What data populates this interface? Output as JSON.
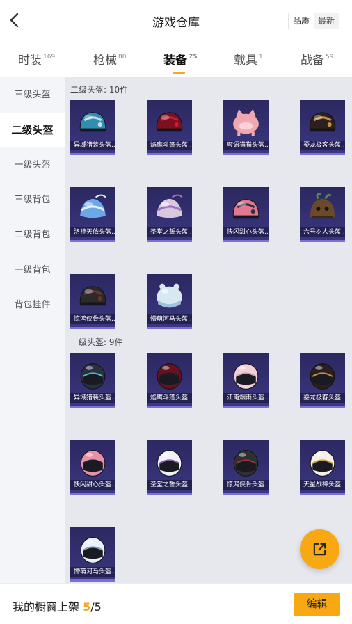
{
  "header": {
    "title": "游戏仓库",
    "sort_options": [
      "品质",
      "最新"
    ],
    "sort_selected": "品质"
  },
  "tabs": [
    {
      "label": "时装",
      "count": "169"
    },
    {
      "label": "枪械",
      "count": "80"
    },
    {
      "label": "装备",
      "count": "75",
      "active": true
    },
    {
      "label": "载具",
      "count": "1"
    },
    {
      "label": "战备",
      "count": "59"
    }
  ],
  "sidebar": {
    "items": [
      "三级头盔",
      "二级头盔",
      "一级头盔",
      "三级背包",
      "二级背包",
      "一级背包",
      "背包挂件"
    ],
    "active_index": 1
  },
  "sections": [
    {
      "title": "二级头盔: 10件",
      "items": [
        {
          "name": "异域猎装头盔...",
          "color": "#2f8fb0",
          "accent": "#c8d8e8",
          "icon": "cap-helmet-icon"
        },
        {
          "name": "焰鹰斗篷头盔...",
          "color": "#7a1020",
          "accent": "#c0203a",
          "icon": "cap-helmet-icon"
        },
        {
          "name": "蜜语猫猫头盔...",
          "color": "#f0a8b0",
          "accent": "#ffd0d8",
          "icon": "cat-helmet-icon"
        },
        {
          "name": "鎏龙极客头盔...",
          "color": "#2a2020",
          "accent": "#c89040",
          "icon": "cap-helmet-icon"
        },
        {
          "name": "洛神天依头盔...",
          "color": "#6aa8e8",
          "accent": "#e0f0ff",
          "icon": "ornate-helmet-icon"
        },
        {
          "name": "圣堂之誓头盔...",
          "color": "#d8c8e0",
          "accent": "#a070c0",
          "icon": "ornate-helmet-icon"
        },
        {
          "name": "快闪甜心头盔...",
          "color": "#e07890",
          "accent": "#303040",
          "icon": "cap-helmet-icon"
        },
        {
          "name": "六号树人头盔...",
          "color": "#6a4a2a",
          "accent": "#5a8a3a",
          "icon": "tree-helmet-icon"
        },
        {
          "name": "惊鸿侠骨头盔...",
          "color": "#2a2a2a",
          "accent": "#703030",
          "icon": "cap-helmet-icon"
        },
        {
          "name": "懵萌河马头盔...",
          "color": "#d8e8f0",
          "accent": "#a0c0e0",
          "icon": "hippo-helmet-icon"
        }
      ]
    },
    {
      "title": "一级头盔: 9件",
      "items": [
        {
          "name": "异域猎装头盔...",
          "color": "#2a3040",
          "accent": "#40c0c8",
          "icon": "full-helmet-icon"
        },
        {
          "name": "焰鹰斗篷头盔...",
          "color": "#6a1020",
          "accent": "#202020",
          "icon": "full-helmet-icon"
        },
        {
          "name": "江南烟雨头盔...",
          "color": "#f0d0d8",
          "accent": "#c0a0b0",
          "icon": "full-helmet-icon"
        },
        {
          "name": "鎏龙极客头盔...",
          "color": "#2a2020",
          "accent": "#c89040",
          "icon": "full-helmet-icon"
        },
        {
          "name": "快闪甜心头盔...",
          "color": "#e890a8",
          "accent": "#202030",
          "icon": "full-helmet-icon"
        },
        {
          "name": "圣堂之誓头盔...",
          "color": "#f0f0f8",
          "accent": "#8060a0",
          "icon": "full-helmet-icon"
        },
        {
          "name": "惊鸿侠骨头盔...",
          "color": "#303030",
          "accent": "#a03040",
          "icon": "full-helmet-icon"
        },
        {
          "name": "天星战神头盔...",
          "color": "#f4f0e8",
          "accent": "#d0a040",
          "icon": "full-helmet-icon"
        },
        {
          "name": "懵萌河马头盔...",
          "color": "#e8f0f8",
          "accent": "#80a0c8",
          "icon": "full-helmet-icon"
        }
      ]
    }
  ],
  "bottom": {
    "label": "我的橱窗上架",
    "count_used": "5",
    "count_sep": "/",
    "count_total": "5",
    "edit_label": "编辑"
  },
  "icons": {
    "back": "chevron-left-icon",
    "share": "share-external-icon"
  }
}
